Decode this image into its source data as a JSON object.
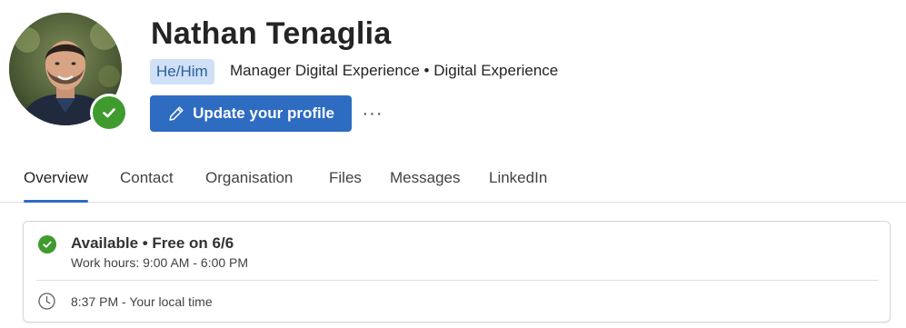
{
  "profile": {
    "name": "Nathan Tenaglia",
    "pronouns": "He/Him",
    "job_line": "Manager Digital Experience • Digital Experience",
    "update_button_label": "Update your profile",
    "more_label": "···",
    "presence_status": "available",
    "presence_color": "#3f9b2e"
  },
  "tabs": [
    {
      "label": "Overview",
      "active": true
    },
    {
      "label": "Contact",
      "active": false
    },
    {
      "label": "Organisation",
      "active": false
    },
    {
      "label": "Files",
      "active": false
    },
    {
      "label": "Messages",
      "active": false
    },
    {
      "label": "LinkedIn",
      "active": false
    }
  ],
  "availability": {
    "title": "Available • Free on 6/6",
    "work_hours": "Work hours: 9:00 AM - 6:00 PM",
    "local_time": "8:37 PM - Your local time"
  },
  "icons": {
    "presence": "check-icon",
    "update": "pencil-icon",
    "more": "more-icon",
    "availability": "check-circle-icon",
    "time": "clock-icon"
  },
  "colors": {
    "accent": "#2e6cc2",
    "pronoun_bg": "#cfe0f7",
    "available_green": "#3f9b2e"
  }
}
